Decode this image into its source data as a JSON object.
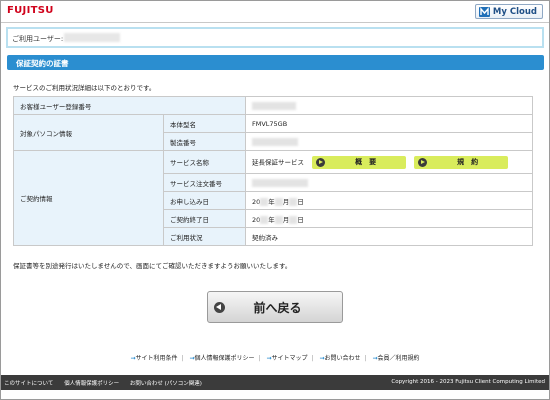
{
  "header": {
    "logo_text": "FUJITSU",
    "mycloud_label": "My Cloud"
  },
  "user": {
    "label": "ご利用ユーザー:"
  },
  "section": {
    "title": "保証契約の証書"
  },
  "intro": "サービスのご利用状況詳細は以下のとおりです。",
  "table": {
    "registration_number_label": "お客様ユーザー登録番号",
    "target_pc_label": "対象パソコン情報",
    "model_label": "本体型名",
    "model_value": "FMVL75GB",
    "serial_label": "製造番号",
    "contract_info_label": "ご契約情報",
    "service_name_label": "サービス名称",
    "service_name_value": "延長保証サービス",
    "overview_button": "概　要",
    "terms_button": "規　約",
    "order_number_label": "サービス注文番号",
    "apply_date_label": "お申し込み日",
    "apply_date_value_prefix": "20",
    "apply_date_year": "年",
    "apply_date_month": "月",
    "apply_date_day": "日",
    "end_date_label": "ご契約終了日",
    "end_date_value_prefix": "20",
    "end_date_year": "年",
    "end_date_month": "月",
    "end_date_day": "日",
    "status_label": "ご利用状況",
    "status_value": "契約済み"
  },
  "notice": "保証書等を別途発行はいたしませんので、画面にてご確認いただきますようお願いいたします。",
  "back_button": "前へ戻る",
  "footer_links": [
    "サイト利用条件",
    "個人情報保護ポリシー",
    "サイトマップ",
    "お問い合わせ",
    "会員／利用規約"
  ],
  "footer_bar": {
    "left": [
      "このサイトについて",
      "個人情報保護ポリシー",
      "お問い合わせ (パソコン関連)"
    ],
    "copyright": "Copyright 2016 - 2023 Fujitsu Client Computing Limited"
  },
  "colors": {
    "brand_red": "#d0021b",
    "section_blue": "#2b8ed0",
    "pill_green": "#d9ec5c",
    "footer_dark": "#3b3b3b"
  }
}
